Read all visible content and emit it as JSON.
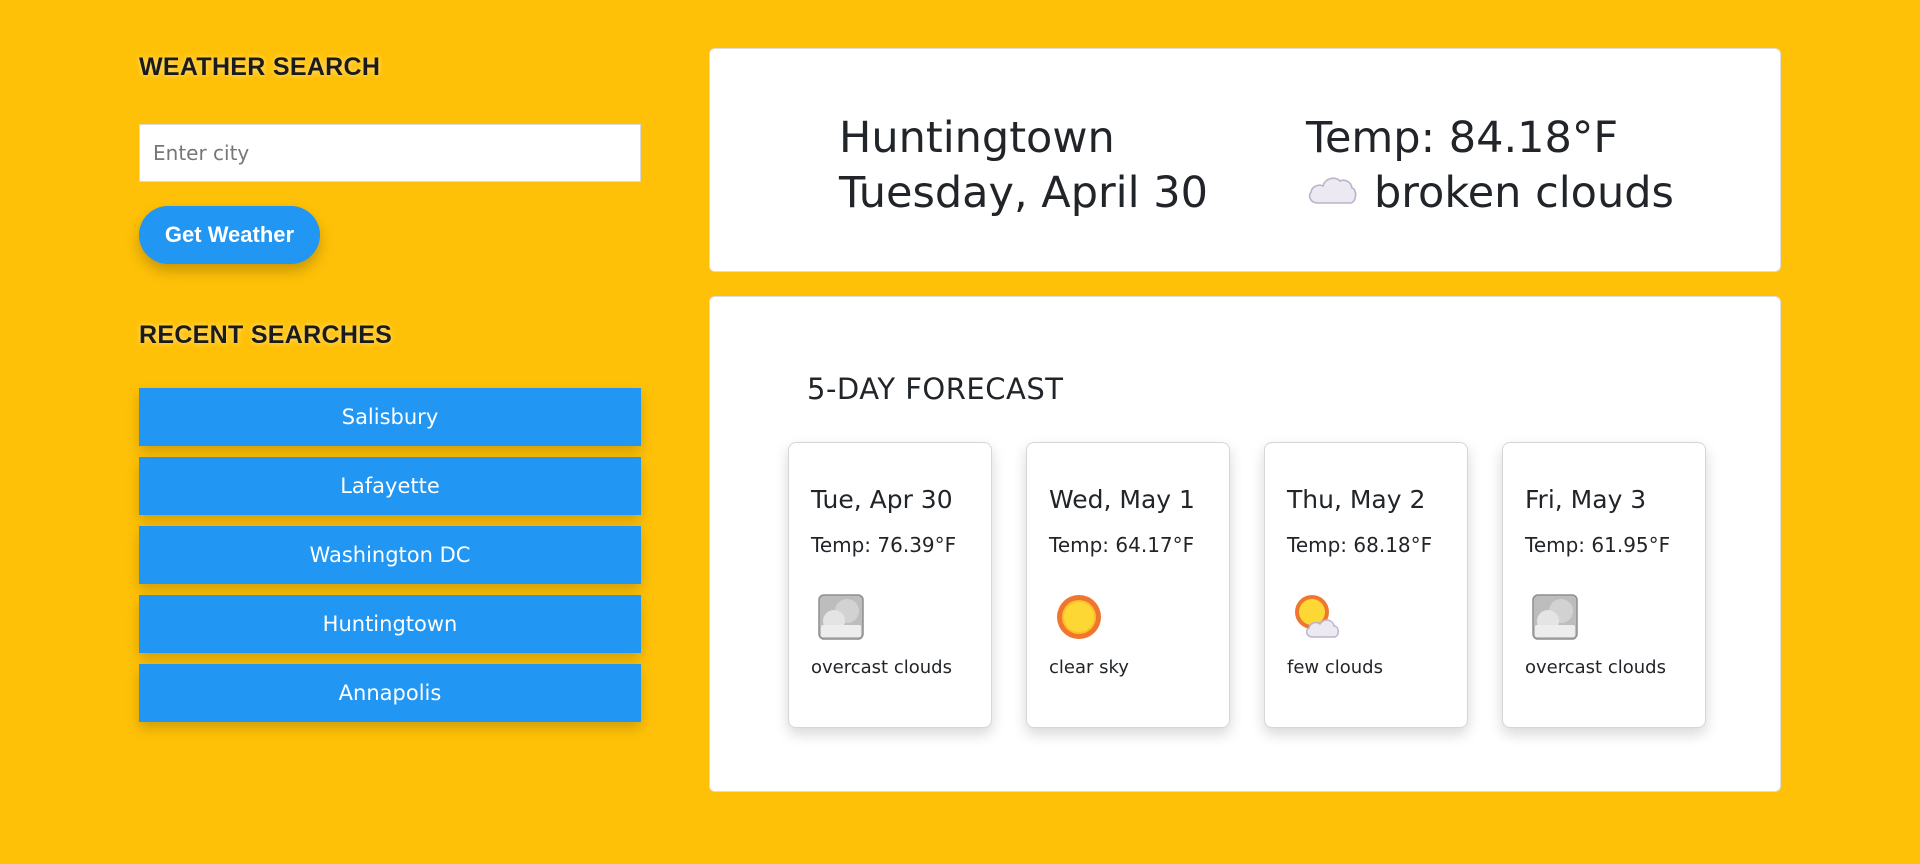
{
  "search": {
    "title": "WEATHER SEARCH",
    "placeholder": "Enter city",
    "value": "",
    "button_label": "Get Weather"
  },
  "recent": {
    "title": "RECENT SEARCHES",
    "items": [
      "Salisbury",
      "Lafayette",
      "Washington DC",
      "Huntingtown",
      "Annapolis"
    ]
  },
  "current": {
    "city": "Huntingtown",
    "date": "Tuesday, April 30",
    "temp": "Temp: 84.18°F",
    "description": "broken clouds",
    "icon": "broken-clouds-icon"
  },
  "forecast": {
    "title": "5-DAY FORECAST",
    "days": [
      {
        "date": "Tue, Apr 30",
        "temp": "Temp: 76.39°F",
        "description": "overcast clouds",
        "icon": "overcast-clouds-icon"
      },
      {
        "date": "Wed, May 1",
        "temp": "Temp: 64.17°F",
        "description": "clear sky",
        "icon": "clear-sky-sun-icon"
      },
      {
        "date": "Thu, May 2",
        "temp": "Temp: 68.18°F",
        "description": "few clouds",
        "icon": "few-clouds-icon"
      },
      {
        "date": "Fri, May 3",
        "temp": "Temp: 61.95°F",
        "description": "overcast clouds",
        "icon": "overcast-clouds-icon"
      }
    ]
  },
  "colors": {
    "page_background": "#FFC107",
    "accent_blue": "#2196F3",
    "card_background": "#FFFFFF"
  }
}
